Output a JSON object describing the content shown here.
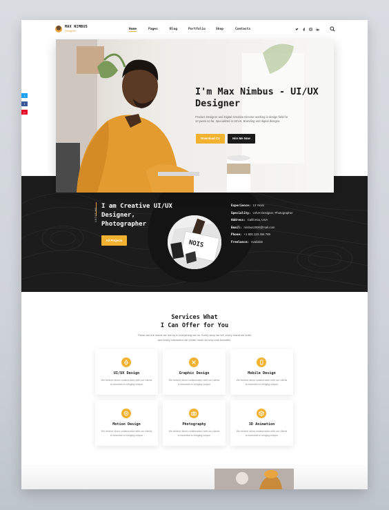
{
  "brand": {
    "name": "MAX NIMBUS",
    "role": "Designer"
  },
  "nav": {
    "items": [
      {
        "label": "Home",
        "active": true
      },
      {
        "label": "Pages",
        "active": false
      },
      {
        "label": "Blog",
        "active": false
      },
      {
        "label": "Portfolio",
        "active": false
      },
      {
        "label": "Shop",
        "active": false
      },
      {
        "label": "Contacts",
        "active": false
      }
    ],
    "social": [
      "twitter-icon",
      "facebook-icon",
      "instagram-icon",
      "linkedin-icon"
    ],
    "search_icon": "search-icon"
  },
  "side_social": [
    {
      "icon": "twitter-icon",
      "color": "#1da1f2"
    },
    {
      "icon": "facebook-icon",
      "color": "#3b5998"
    },
    {
      "icon": "pinterest-icon",
      "color": "#e60023"
    }
  ],
  "hero": {
    "title": "I'm Max Nimbus - UI/UX Designer",
    "description": "Product Designer and Digital Creative Director working in design field for 13 years so far, specialized in UI/UX, Branding and digital designs.",
    "primary_button": "Download CV",
    "secondary_button": "Hire Me Now"
  },
  "about": {
    "vertical_label": "ABOUT ME",
    "title": "I am Creative UI/UX Designer, Photographer",
    "button": "All Projects",
    "info": [
      {
        "label": "Experience:",
        "value": "13 Years"
      },
      {
        "label": "Speciality:",
        "value": "UI/UX Designer, Photographer"
      },
      {
        "label": "Address:",
        "value": "California, USA"
      },
      {
        "label": "Email:",
        "value": "nimbus2000@mail.com"
      },
      {
        "label": "Phone:",
        "value": "+1 800 123 456 789"
      },
      {
        "label": "Freelance:",
        "value": "Available"
      }
    ]
  },
  "services": {
    "title_line1": "Services What",
    "title_line2": "I Can Offer for You",
    "description": "These are the words we live by in everything we do. Every story we tell, every brand we build, and every interaction we create must not only look beautiful.",
    "items": [
      {
        "title": "UI/UX Design",
        "icon": "pen-tool-icon",
        "desc": "We believe direct collaboration with our clients is essential to bringing unique"
      },
      {
        "title": "Graphic Design",
        "icon": "crossed-tools-icon",
        "desc": "We believe direct collaboration with our clients is essential to bringing unique"
      },
      {
        "title": "Mobile Design",
        "icon": "mobile-icon",
        "desc": "We believe direct collaboration with our clients is essential to bringing unique"
      },
      {
        "title": "Motion Design",
        "icon": "motion-icon",
        "desc": "We believe direct collaboration with our clients is essential to bringing unique"
      },
      {
        "title": "Photography",
        "icon": "camera-icon",
        "desc": "We believe direct collaboration with our clients is essential to bringing unique"
      },
      {
        "title": "3D Animation",
        "icon": "cube-icon",
        "desc": "We believe direct collaboration with our clients is essential to bringing unique"
      }
    ]
  },
  "colors": {
    "accent": "#f2b230",
    "dark": "#1c1c1c"
  }
}
